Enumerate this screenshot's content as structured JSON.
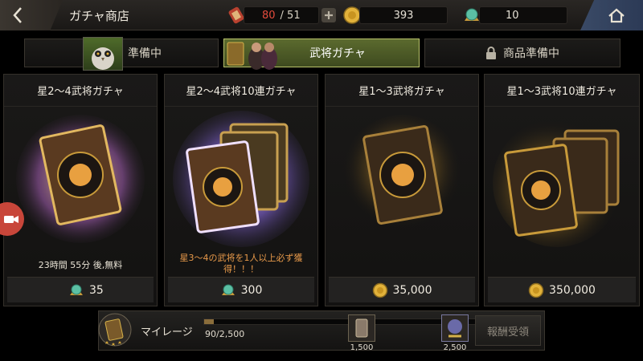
{
  "header": {
    "title": "ガチャ商店",
    "stamina_current": "80",
    "stamina_max": "/ 51",
    "gold": "393",
    "gems": "10"
  },
  "tabs": [
    {
      "label": "準備中",
      "active": false
    },
    {
      "label": "武将ガチャ",
      "active": true
    },
    {
      "label": "商品準備中",
      "active": false
    }
  ],
  "cards": [
    {
      "title": "星2～4武将ガチャ",
      "note": "23時間 55分 後,無料",
      "price": "35",
      "currency": "gem-icon"
    },
    {
      "title": "星2～4武将10連ガチャ",
      "note": "星3～4の武将を1人以上必ず獲得！！！",
      "price": "300",
      "currency": "gem-icon"
    },
    {
      "title": "星1～3武将ガチャ",
      "note": "",
      "price": "35,000",
      "currency": "gold-coin-icon"
    },
    {
      "title": "星1～3武将10連ガチャ",
      "note": "",
      "price": "350,000",
      "currency": "gold-coin-icon"
    }
  ],
  "mileage": {
    "label": "マイレージ",
    "progress_text": "90/2,500",
    "progress_fraction": 0.036,
    "milestones": [
      "1,500",
      "2,500"
    ],
    "claim_label": "報酬受領"
  },
  "colors": {
    "accent_tab": "#5b6a2e",
    "stamina_red": "#e34b3c",
    "gold": "#e2b23a",
    "note_orange": "#e89a4a"
  }
}
